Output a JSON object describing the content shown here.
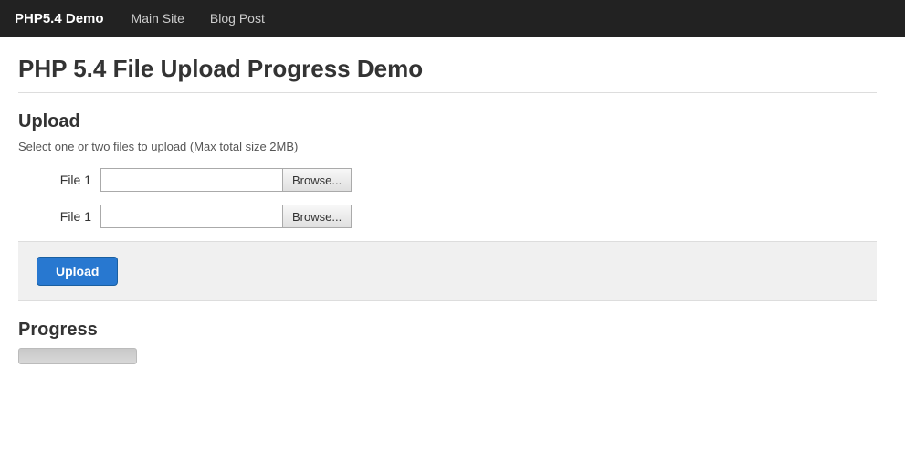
{
  "nav": {
    "brand": "PHP5.4 Demo",
    "links": [
      {
        "label": "Main Site"
      },
      {
        "label": "Blog Post"
      }
    ]
  },
  "page": {
    "title": "PHP 5.4 File Upload Progress Demo",
    "upload_section": {
      "heading": "Upload",
      "description": "Select one or two files to upload (Max total size 2MB)",
      "file1_label": "File 1",
      "file2_label": "File 1",
      "browse1_label": "Browse...",
      "browse2_label": "Browse...",
      "upload_button_label": "Upload"
    },
    "progress_section": {
      "heading": "Progress"
    }
  }
}
